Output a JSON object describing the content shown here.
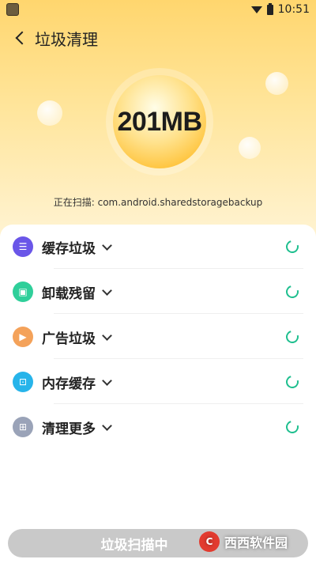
{
  "status_bar": {
    "time": "10:51"
  },
  "header": {
    "title": "垃圾清理"
  },
  "scan": {
    "size": "201MB",
    "status_text": "正在扫描: com.android.sharedstoragebackup"
  },
  "categories": [
    {
      "label": "缓存垃圾",
      "icon": "list-icon",
      "color": "#6a56e8"
    },
    {
      "label": "卸载残留",
      "icon": "android-icon",
      "color": "#2fcf9a"
    },
    {
      "label": "广告垃圾",
      "icon": "video-icon",
      "color": "#f4a25a"
    },
    {
      "label": "内存缓存",
      "icon": "chip-icon",
      "color": "#27b4ea"
    },
    {
      "label": "清理更多",
      "icon": "grid-icon",
      "color": "#9aa3b8"
    }
  ],
  "bottom": {
    "button_label": "垃圾扫描中",
    "watermark_text": "西西软件园"
  },
  "colors": {
    "spinner": "#1fbf8f",
    "header_top": "#ffd66e"
  }
}
